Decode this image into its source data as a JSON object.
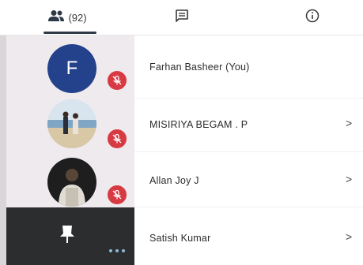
{
  "tabs": {
    "people": {
      "icon": "people-icon",
      "count": "(92)"
    },
    "chat": {
      "icon": "chat-icon"
    },
    "info": {
      "icon": "info-icon"
    }
  },
  "participants": [
    {
      "name": "Farhan Basheer (You)",
      "avatar_letter": "F",
      "avatar_color": "#24418c",
      "muted": true,
      "has_chevron": false
    },
    {
      "name": "MISIRIYA BEGAM . P",
      "avatar": "beach-photo",
      "muted": true,
      "has_chevron": true
    },
    {
      "name": "Allan Joy J",
      "avatar": "person-photo",
      "muted": true,
      "has_chevron": true
    },
    {
      "name": "Satish Kumar",
      "tile_icon": "pin-icon",
      "has_chevron": true
    }
  ],
  "chevron": ">",
  "colors": {
    "mute_red": "#d73a43",
    "avatar_blue": "#24418c",
    "rail_bg": "#efeaee",
    "video_tile_bg": "#2b2d2f"
  }
}
